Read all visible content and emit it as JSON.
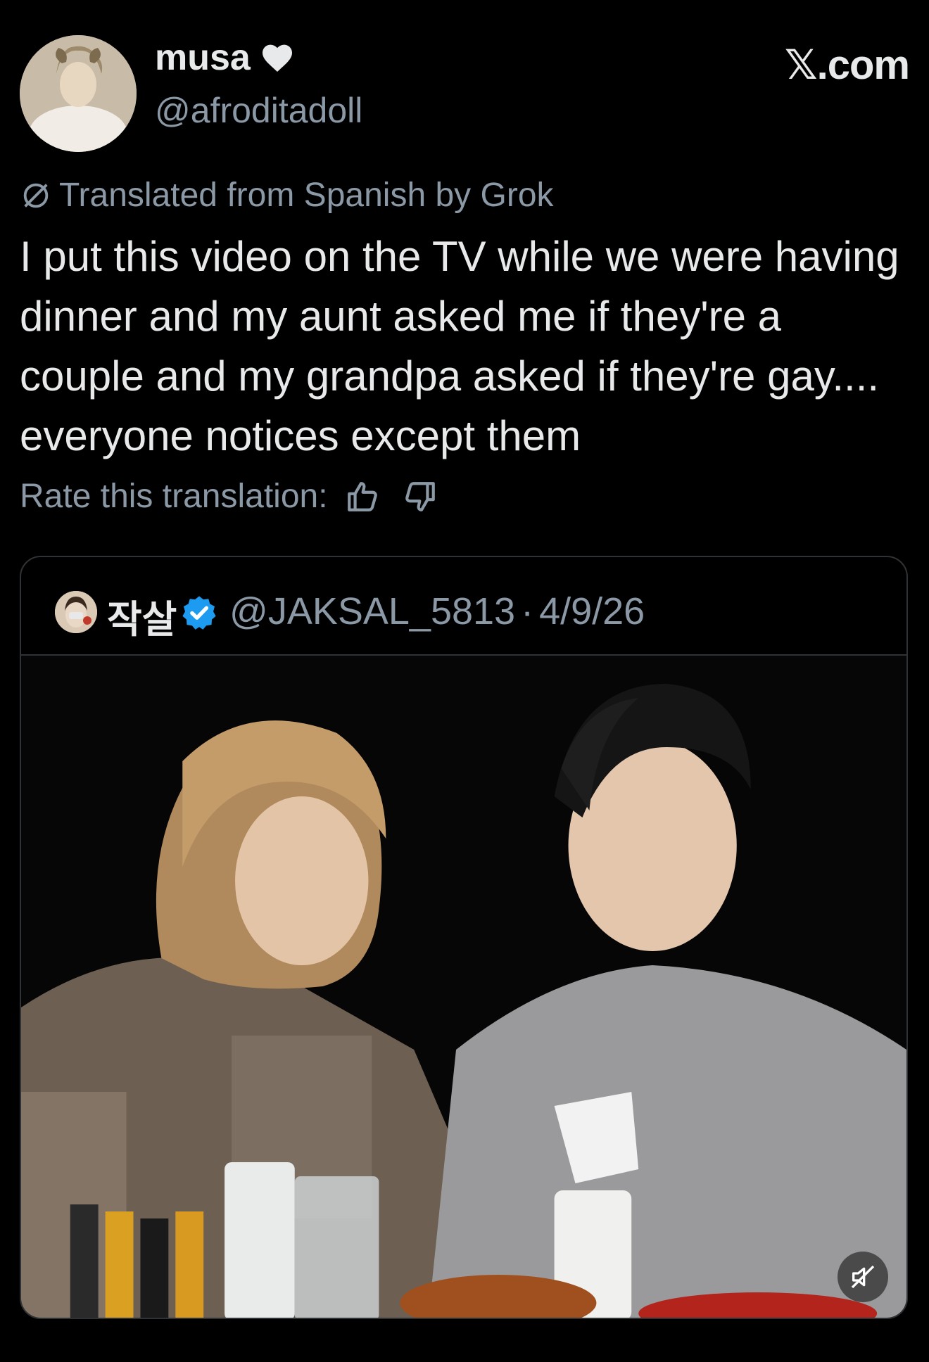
{
  "author": {
    "display_name": "musa",
    "handle": "@afroditadoll",
    "heart_icon": "heart-icon"
  },
  "site_logo": "𝕏.com",
  "translation": {
    "note": "Translated from Spanish by Grok",
    "icon": "translate-icon"
  },
  "tweet": {
    "text": "I put this video on the TV while we were having dinner and my aunt asked me if they're a couple and my grandpa asked if they're gay.... everyone notices except them"
  },
  "rating": {
    "label": "Rate this translation:",
    "thumbs_up_icon": "thumbs-up-icon",
    "thumbs_down_icon": "thumbs-down-icon"
  },
  "quoted_post": {
    "display_name": "작살",
    "verified": true,
    "handle": "@JAKSAL_5813",
    "separator": "·",
    "date": "4/9/26",
    "media_type": "video",
    "mute_icon": "mute-icon"
  },
  "colors": {
    "background": "#000000",
    "primary_text": "#e7e9ea",
    "secondary_text": "#8b98a5",
    "border": "#2f3336",
    "verified_blue": "#1d9bf0"
  }
}
